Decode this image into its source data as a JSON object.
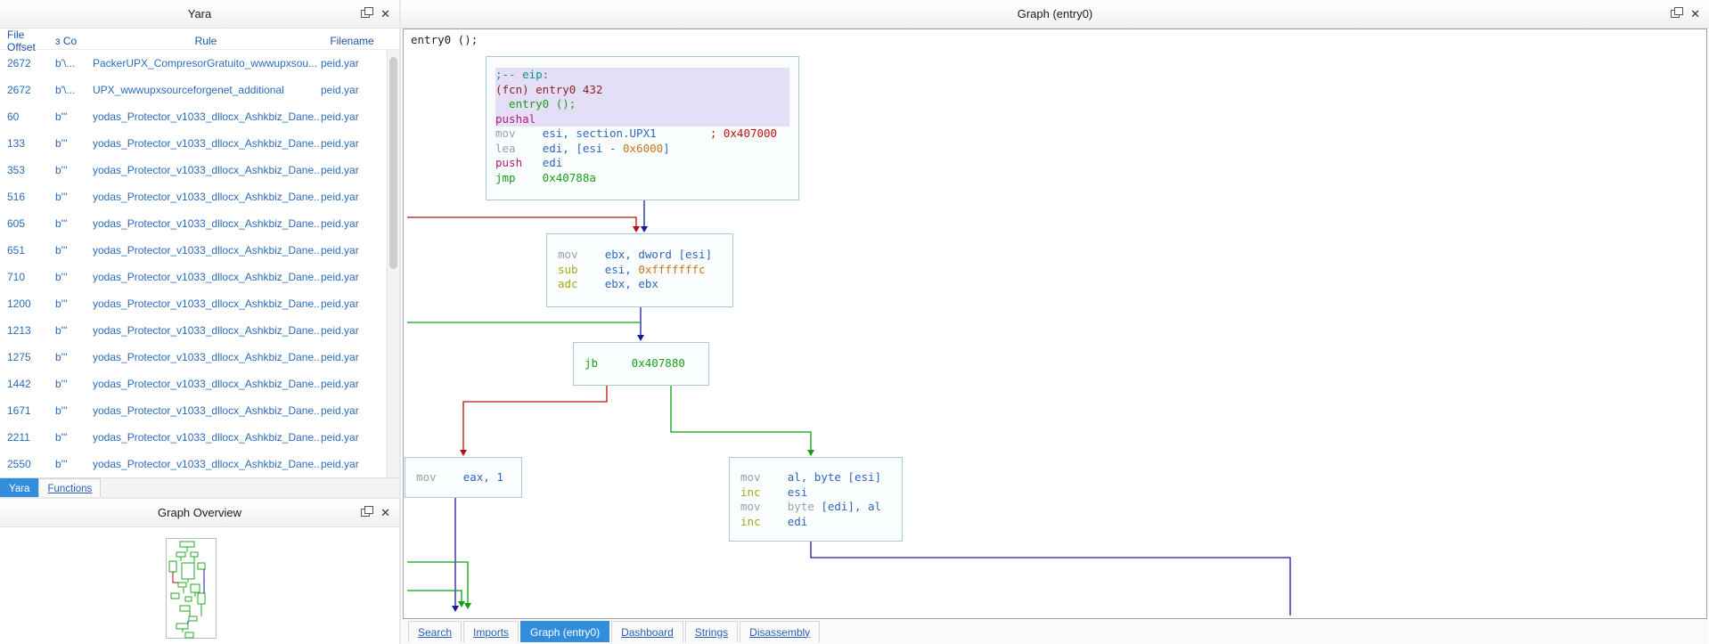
{
  "colors": {
    "accent_blue": "#338ddd",
    "row_text": "#2a6cb8",
    "edge_blue": "#1a1aa0",
    "edge_red": "#b31010",
    "edge_green": "#0fa00f",
    "highlight": "#e4def6"
  },
  "yara_panel": {
    "title": "Yara",
    "header": {
      "file_offset": "File Offset",
      "sort_glyph": "ɜ",
      "content": "Co",
      "rule": "Rule",
      "filename": "Filename"
    },
    "rows": [
      {
        "offset": "2672",
        "content": "b'\\...",
        "rule": "PackerUPX_CompresorGratuito_wwwupxsou...",
        "filename": "peid.yar"
      },
      {
        "offset": "2672",
        "content": "b'\\...",
        "rule": "UPX_wwwupxsourceforgenet_additional",
        "filename": "peid.yar"
      },
      {
        "offset": "60",
        "content": "b'''",
        "rule": "yodas_Protector_v1033_dllocx_Ashkbiz_Dane...",
        "filename": "peid.yar"
      },
      {
        "offset": "133",
        "content": "b'''",
        "rule": "yodas_Protector_v1033_dllocx_Ashkbiz_Dane...",
        "filename": "peid.yar"
      },
      {
        "offset": "353",
        "content": "b'''",
        "rule": "yodas_Protector_v1033_dllocx_Ashkbiz_Dane...",
        "filename": "peid.yar"
      },
      {
        "offset": "516",
        "content": "b'''",
        "rule": "yodas_Protector_v1033_dllocx_Ashkbiz_Dane...",
        "filename": "peid.yar"
      },
      {
        "offset": "605",
        "content": "b'''",
        "rule": "yodas_Protector_v1033_dllocx_Ashkbiz_Dane...",
        "filename": "peid.yar"
      },
      {
        "offset": "651",
        "content": "b'''",
        "rule": "yodas_Protector_v1033_dllocx_Ashkbiz_Dane...",
        "filename": "peid.yar"
      },
      {
        "offset": "710",
        "content": "b'''",
        "rule": "yodas_Protector_v1033_dllocx_Ashkbiz_Dane...",
        "filename": "peid.yar"
      },
      {
        "offset": "1200",
        "content": "b'''",
        "rule": "yodas_Protector_v1033_dllocx_Ashkbiz_Dane...",
        "filename": "peid.yar"
      },
      {
        "offset": "1213",
        "content": "b'''",
        "rule": "yodas_Protector_v1033_dllocx_Ashkbiz_Dane...",
        "filename": "peid.yar"
      },
      {
        "offset": "1275",
        "content": "b'''",
        "rule": "yodas_Protector_v1033_dllocx_Ashkbiz_Dane...",
        "filename": "peid.yar"
      },
      {
        "offset": "1442",
        "content": "b'''",
        "rule": "yodas_Protector_v1033_dllocx_Ashkbiz_Dane...",
        "filename": "peid.yar"
      },
      {
        "offset": "1671",
        "content": "b'''",
        "rule": "yodas_Protector_v1033_dllocx_Ashkbiz_Dane...",
        "filename": "peid.yar"
      },
      {
        "offset": "2211",
        "content": "b'''",
        "rule": "yodas_Protector_v1033_dllocx_Ashkbiz_Dane...",
        "filename": "peid.yar"
      },
      {
        "offset": "2550",
        "content": "b'''",
        "rule": "yodas_Protector_v1033_dllocx_Ashkbiz_Dane...",
        "filename": "peid.yar"
      }
    ],
    "tabs": [
      {
        "label": "Yara",
        "selected": true
      },
      {
        "label": "Functions",
        "selected": false
      }
    ]
  },
  "overview_panel": {
    "title": "Graph Overview"
  },
  "graph_panel": {
    "title": "Graph (entry0)",
    "function_label": "entry0 ();",
    "tabs": [
      {
        "label": "Search"
      },
      {
        "label": "Imports"
      },
      {
        "label": "Graph (entry0)",
        "selected": true
      },
      {
        "label": "Dashboard"
      },
      {
        "label": "Strings"
      },
      {
        "label": "Disassembly"
      }
    ],
    "blocks": [
      {
        "name": "entry-block",
        "lines": [
          {
            "hl": true,
            "segs": [
              {
                "t": ";-- eip:",
                "c": "teal"
              }
            ]
          },
          {
            "hl": true,
            "segs": [
              {
                "t": "(fcn) entry0 432",
                "c": "maroon"
              }
            ]
          },
          {
            "hl": true,
            "segs": [
              {
                "t": "  entry0 ();",
                "c": "green"
              }
            ]
          },
          {
            "hl": true,
            "segs": [
              {
                "t": "pushal",
                "c": "magenta"
              }
            ]
          },
          {
            "segs": [
              {
                "t": "mov    ",
                "c": "gray"
              },
              {
                "t": "esi, section.UPX1",
                "c": "blue"
              },
              {
                "t": "        ; 0x407000",
                "c": "red"
              }
            ]
          },
          {
            "segs": [
              {
                "t": "lea    ",
                "c": "gray"
              },
              {
                "t": "edi, [esi - ",
                "c": "blue"
              },
              {
                "t": "0x6000",
                "c": "orange"
              },
              {
                "t": "]",
                "c": "blue"
              }
            ]
          },
          {
            "segs": [
              {
                "t": "push   ",
                "c": "magenta"
              },
              {
                "t": "edi",
                "c": "blue"
              }
            ]
          },
          {
            "segs": [
              {
                "t": "jmp    0x40788a",
                "c": "green"
              }
            ]
          }
        ]
      },
      {
        "name": "loop-head-block",
        "lines": [
          {
            "segs": [
              {
                "t": "mov    ",
                "c": "gray"
              },
              {
                "t": "ebx, dword [esi]",
                "c": "blue"
              }
            ]
          },
          {
            "segs": [
              {
                "t": "sub    ",
                "c": "olive"
              },
              {
                "t": "esi, ",
                "c": "blue"
              },
              {
                "t": "0xfffffffc",
                "c": "orange"
              }
            ]
          },
          {
            "segs": [
              {
                "t": "adc    ",
                "c": "olive"
              },
              {
                "t": "ebx, ebx",
                "c": "blue"
              }
            ]
          }
        ]
      },
      {
        "name": "branch-block",
        "lines": [
          {
            "segs": [
              {
                "t": "jb     0x407880",
                "c": "green"
              }
            ]
          }
        ]
      },
      {
        "name": "mov-eax-block",
        "lines": [
          {
            "segs": [
              {
                "t": "mov    ",
                "c": "gray"
              },
              {
                "t": "eax, 1",
                "c": "blue"
              }
            ]
          }
        ]
      },
      {
        "name": "copy-byte-block",
        "lines": [
          {
            "segs": [
              {
                "t": "mov    ",
                "c": "gray"
              },
              {
                "t": "al, byte [esi]",
                "c": "blue"
              }
            ]
          },
          {
            "segs": [
              {
                "t": "inc    ",
                "c": "olive"
              },
              {
                "t": "esi",
                "c": "blue"
              }
            ]
          },
          {
            "segs": [
              {
                "t": "mov    ",
                "c": "gray"
              },
              {
                "t": "byte ",
                "c": "gray"
              },
              {
                "t": "[edi], al",
                "c": "blue"
              }
            ]
          },
          {
            "segs": [
              {
                "t": "inc    ",
                "c": "olive"
              },
              {
                "t": "edi",
                "c": "blue"
              }
            ]
          }
        ]
      }
    ]
  }
}
